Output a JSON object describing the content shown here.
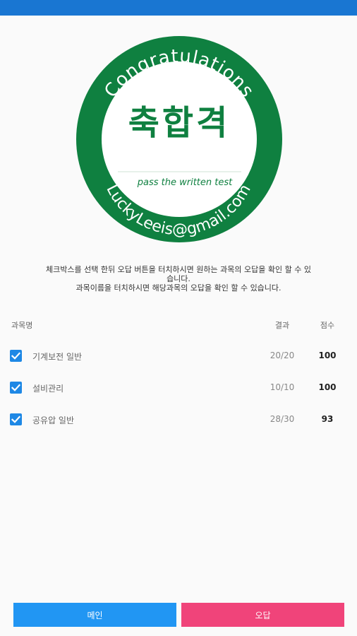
{
  "seal": {
    "top_text": "Congratulations",
    "center_text": "축합격",
    "sub_text": "pass the written test",
    "bottom_text": "LuckyLeeis@gmail.com",
    "ring_color": "#0f8040",
    "text_color": "#0f8040"
  },
  "notice": {
    "line1": "체크박스를 선택 한뒤 오답 버튼을 터치하시면 원하는 과목의 오답을 확인 할 수 있",
    "line2": "습니다.",
    "line3": "과목이름을 터치하시면 해당과목의 오답을 확인 할 수 있습니다."
  },
  "table": {
    "headers": {
      "subject": "과목명",
      "result": "결과",
      "score": "점수"
    },
    "rows": [
      {
        "subject": "기계보전 일반",
        "result": "20/20",
        "score": "100",
        "checked": true
      },
      {
        "subject": "설비관리",
        "result": "10/10",
        "score": "100",
        "checked": true
      },
      {
        "subject": "공유압 일반",
        "result": "28/30",
        "score": "93",
        "checked": true
      }
    ]
  },
  "buttons": {
    "main_label": "메인",
    "wrong_label": "오답"
  },
  "colors": {
    "status_bar": "#1976d2",
    "checkbox": "#1e88e5",
    "main_button": "#2196f3",
    "wrong_button": "#f0447a"
  }
}
